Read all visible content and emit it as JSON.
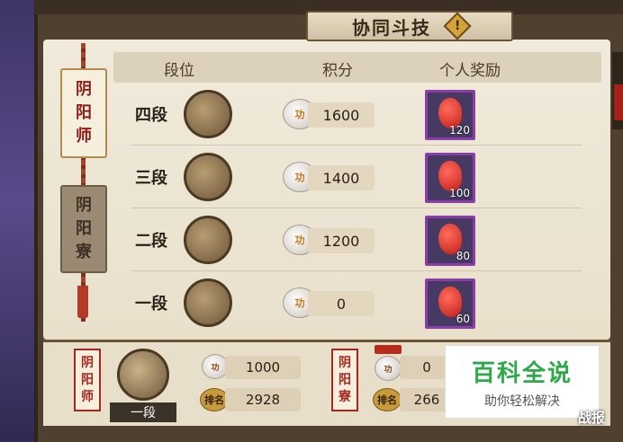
{
  "title": "协同斗技",
  "tabs": [
    {
      "label": [
        "阴",
        "阳",
        "师"
      ],
      "active": true
    },
    {
      "label": [
        "阴",
        "阳",
        "寮"
      ],
      "active": false
    }
  ],
  "table": {
    "headers": {
      "rank": "段位",
      "score": "积分",
      "reward": "个人奖励"
    },
    "score_icon_text": "功",
    "rows": [
      {
        "rank": "四段",
        "score": "1600",
        "reward_qty": "120"
      },
      {
        "rank": "三段",
        "score": "1400",
        "reward_qty": "100"
      },
      {
        "rank": "二段",
        "score": "1200",
        "reward_qty": "80"
      },
      {
        "rank": "一段",
        "score": "0",
        "reward_qty": "60"
      }
    ]
  },
  "bottom": {
    "left_badge": [
      "阴",
      "阳",
      "师"
    ],
    "my_rank": "一段",
    "my_score": "1000",
    "my_rank_tag": "排名",
    "my_ranking": "2928",
    "right_badge": [
      "阴",
      "阳",
      "寮"
    ],
    "guild_score": "0",
    "guild_rank_tag": "排名",
    "guild_ranking": "266"
  },
  "watermark": {
    "main": "百科全说",
    "sub": "助你轻松解决"
  },
  "battle_button": "战报",
  "colors": {
    "accent_red": "#a8261c",
    "reward_border": "#8a3fa8",
    "watermark_green": "#2fa84a"
  }
}
